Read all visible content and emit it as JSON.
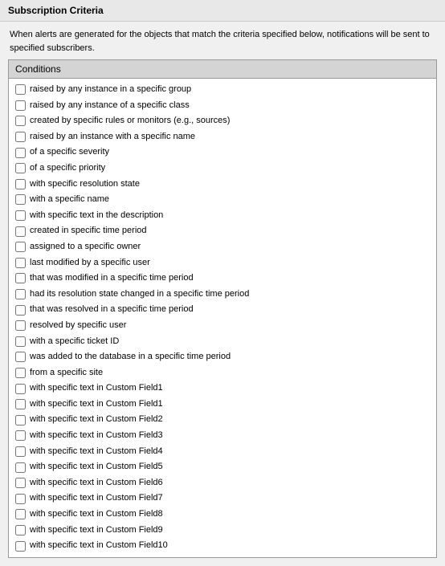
{
  "title": "Subscription Criteria",
  "description": "When alerts are generated for the objects that match the criteria specified below, notifications will be sent to specified subscribers.",
  "conditions_header": "Conditions",
  "conditions": [
    {
      "id": "c1",
      "label": "raised by any instance in a specific group"
    },
    {
      "id": "c2",
      "label": "raised by any instance of a specific class"
    },
    {
      "id": "c3",
      "label": "created by specific rules or monitors (e.g., sources)"
    },
    {
      "id": "c4",
      "label": "raised by an instance with a specific name"
    },
    {
      "id": "c5",
      "label": "of a specific severity"
    },
    {
      "id": "c6",
      "label": "of a specific priority"
    },
    {
      "id": "c7",
      "label": "with specific resolution state"
    },
    {
      "id": "c8",
      "label": "with a specific name"
    },
    {
      "id": "c9",
      "label": "with specific text in the description"
    },
    {
      "id": "c10",
      "label": "created in specific time period"
    },
    {
      "id": "c11",
      "label": "assigned to a specific owner"
    },
    {
      "id": "c12",
      "label": "last modified by a specific user"
    },
    {
      "id": "c13",
      "label": "that was modified in a specific time period"
    },
    {
      "id": "c14",
      "label": "had its resolution state changed in a specific time period"
    },
    {
      "id": "c15",
      "label": "that was resolved in a specific time period"
    },
    {
      "id": "c16",
      "label": "resolved by specific user"
    },
    {
      "id": "c17",
      "label": "with a specific ticket ID"
    },
    {
      "id": "c18",
      "label": "was added to the database in a specific time period"
    },
    {
      "id": "c19",
      "label": "from a specific site"
    },
    {
      "id": "c20",
      "label": "with specific text in Custom Field1"
    },
    {
      "id": "c21",
      "label": "with specific text in Custom Field1"
    },
    {
      "id": "c22",
      "label": "with specific text in Custom Field2"
    },
    {
      "id": "c23",
      "label": "with specific text in Custom Field3"
    },
    {
      "id": "c24",
      "label": "with specific text in Custom Field4"
    },
    {
      "id": "c25",
      "label": "with specific text in Custom Field5"
    },
    {
      "id": "c26",
      "label": "with specific text in Custom Field6"
    },
    {
      "id": "c27",
      "label": "with specific text in Custom Field7"
    },
    {
      "id": "c28",
      "label": "with specific text in Custom Field8"
    },
    {
      "id": "c29",
      "label": "with specific text in Custom Field9"
    },
    {
      "id": "c30",
      "label": "with specific text in Custom Field10"
    }
  ]
}
